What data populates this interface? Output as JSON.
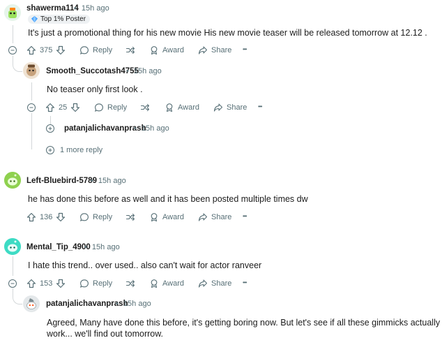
{
  "separator": "•",
  "comments": [
    {
      "username": "shawerma114",
      "time": "15h ago",
      "flair": "Top 1% Poster",
      "text": "It's just a promotional thing for his new movie His new movie teaser will be released tomorrow at 12.12 .",
      "votes": "375",
      "reply": "Reply",
      "award": "Award",
      "share": "Share",
      "more": "•••"
    },
    {
      "username": "Smooth_Succotash4755",
      "time": "15h ago",
      "text": "No teaser only first look .",
      "votes": "25",
      "reply": "Reply",
      "award": "Award",
      "share": "Share",
      "more": "•••"
    },
    {
      "username": "patanjalichavanprash",
      "time": "15h ago"
    },
    {
      "more_replies": "1 more reply"
    },
    {
      "username": "Left-Bluebird-5789",
      "time": "15h ago",
      "text": "he has done this before as well and it has been posted multiple times dw",
      "votes": "136",
      "reply": "Reply",
      "award": "Award",
      "share": "Share",
      "more": "•••"
    },
    {
      "username": "Mental_Tip_4900",
      "time": "15h ago",
      "text": "I hate this trend.. over used.. also can't wait for actor ranveer",
      "votes": "153",
      "reply": "Reply",
      "award": "Award",
      "share": "Share",
      "more": "•••"
    },
    {
      "username": "patanjalichavanprash",
      "time": "15h ago",
      "text_line1": "Agreed, Many have done this before, it's getting boring now. But let's see if all these gimmicks actually",
      "text_line2": "work... we'll find out tomorrow."
    }
  ],
  "colors": {
    "muted": "#576f76",
    "thread_line": "#d3d7d9",
    "avatar_green": "#8fd14f",
    "avatar_teal": "#3ddbc4"
  }
}
